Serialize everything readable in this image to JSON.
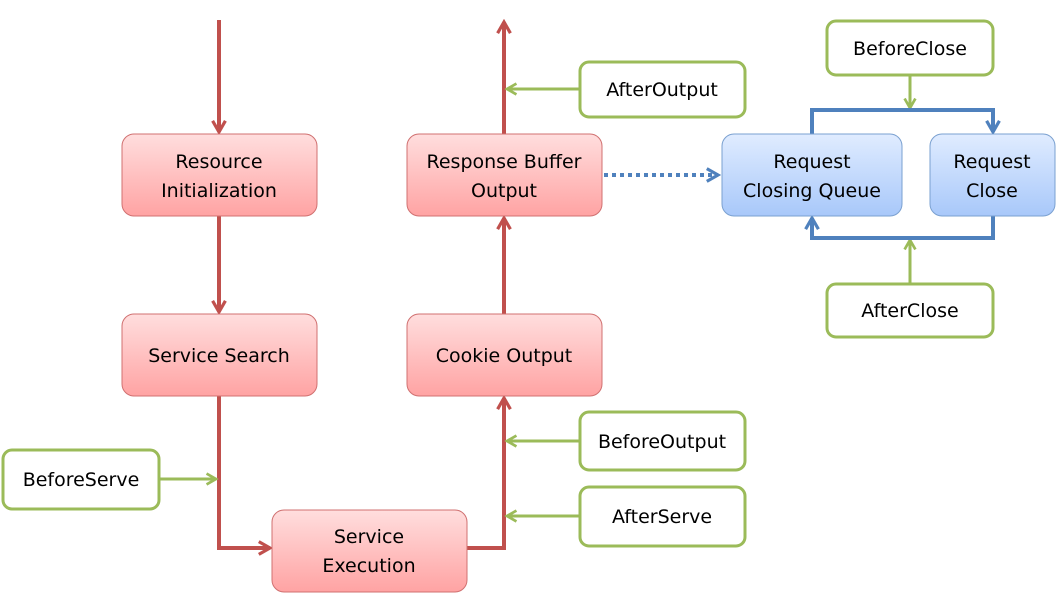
{
  "colors": {
    "flow": "#c0504d",
    "hook": "#9bbb59",
    "close_flow": "#4f81bd"
  },
  "nodes": {
    "resource_init": [
      "Resource",
      "Initialization"
    ],
    "service_search": [
      "Service Search"
    ],
    "service_execution": [
      "Service",
      "Execution"
    ],
    "cookie_output": [
      "Cookie Output"
    ],
    "response_buffer": [
      "Response Buffer",
      "Output"
    ],
    "closing_queue": [
      "Request",
      "Closing Queue"
    ],
    "request_close": [
      "Request",
      "Close"
    ]
  },
  "hooks": {
    "before_serve": "BeforeServe",
    "after_serve": "AfterServe",
    "before_output": "BeforeOutput",
    "after_output": "AfterOutput",
    "before_close": "BeforeClose",
    "after_close": "AfterClose"
  }
}
